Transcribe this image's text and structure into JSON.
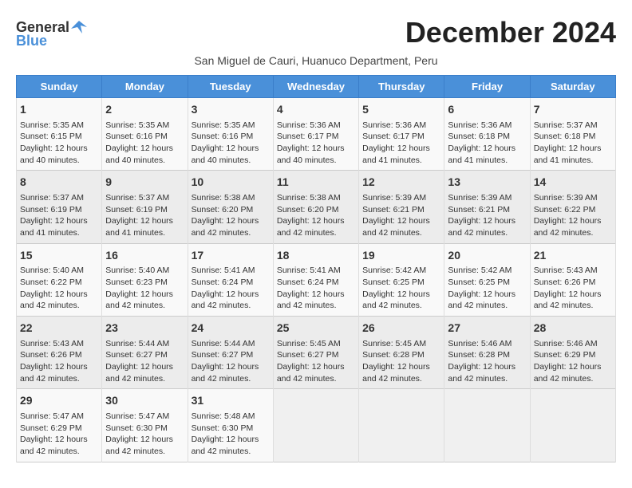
{
  "logo": {
    "general": "General",
    "blue": "Blue",
    "icon": "▶"
  },
  "title": "December 2024",
  "subtitle": "San Miguel de Cauri, Huanuco Department, Peru",
  "headers": [
    "Sunday",
    "Monday",
    "Tuesday",
    "Wednesday",
    "Thursday",
    "Friday",
    "Saturday"
  ],
  "weeks": [
    [
      {
        "day": "1",
        "info": "Sunrise: 5:35 AM\nSunset: 6:15 PM\nDaylight: 12 hours\nand 40 minutes."
      },
      {
        "day": "2",
        "info": "Sunrise: 5:35 AM\nSunset: 6:16 PM\nDaylight: 12 hours\nand 40 minutes."
      },
      {
        "day": "3",
        "info": "Sunrise: 5:35 AM\nSunset: 6:16 PM\nDaylight: 12 hours\nand 40 minutes."
      },
      {
        "day": "4",
        "info": "Sunrise: 5:36 AM\nSunset: 6:17 PM\nDaylight: 12 hours\nand 40 minutes."
      },
      {
        "day": "5",
        "info": "Sunrise: 5:36 AM\nSunset: 6:17 PM\nDaylight: 12 hours\nand 41 minutes."
      },
      {
        "day": "6",
        "info": "Sunrise: 5:36 AM\nSunset: 6:18 PM\nDaylight: 12 hours\nand 41 minutes."
      },
      {
        "day": "7",
        "info": "Sunrise: 5:37 AM\nSunset: 6:18 PM\nDaylight: 12 hours\nand 41 minutes."
      }
    ],
    [
      {
        "day": "8",
        "info": "Sunrise: 5:37 AM\nSunset: 6:19 PM\nDaylight: 12 hours\nand 41 minutes."
      },
      {
        "day": "9",
        "info": "Sunrise: 5:37 AM\nSunset: 6:19 PM\nDaylight: 12 hours\nand 41 minutes."
      },
      {
        "day": "10",
        "info": "Sunrise: 5:38 AM\nSunset: 6:20 PM\nDaylight: 12 hours\nand 42 minutes."
      },
      {
        "day": "11",
        "info": "Sunrise: 5:38 AM\nSunset: 6:20 PM\nDaylight: 12 hours\nand 42 minutes."
      },
      {
        "day": "12",
        "info": "Sunrise: 5:39 AM\nSunset: 6:21 PM\nDaylight: 12 hours\nand 42 minutes."
      },
      {
        "day": "13",
        "info": "Sunrise: 5:39 AM\nSunset: 6:21 PM\nDaylight: 12 hours\nand 42 minutes."
      },
      {
        "day": "14",
        "info": "Sunrise: 5:39 AM\nSunset: 6:22 PM\nDaylight: 12 hours\nand 42 minutes."
      }
    ],
    [
      {
        "day": "15",
        "info": "Sunrise: 5:40 AM\nSunset: 6:22 PM\nDaylight: 12 hours\nand 42 minutes."
      },
      {
        "day": "16",
        "info": "Sunrise: 5:40 AM\nSunset: 6:23 PM\nDaylight: 12 hours\nand 42 minutes."
      },
      {
        "day": "17",
        "info": "Sunrise: 5:41 AM\nSunset: 6:24 PM\nDaylight: 12 hours\nand 42 minutes."
      },
      {
        "day": "18",
        "info": "Sunrise: 5:41 AM\nSunset: 6:24 PM\nDaylight: 12 hours\nand 42 minutes."
      },
      {
        "day": "19",
        "info": "Sunrise: 5:42 AM\nSunset: 6:25 PM\nDaylight: 12 hours\nand 42 minutes."
      },
      {
        "day": "20",
        "info": "Sunrise: 5:42 AM\nSunset: 6:25 PM\nDaylight: 12 hours\nand 42 minutes."
      },
      {
        "day": "21",
        "info": "Sunrise: 5:43 AM\nSunset: 6:26 PM\nDaylight: 12 hours\nand 42 minutes."
      }
    ],
    [
      {
        "day": "22",
        "info": "Sunrise: 5:43 AM\nSunset: 6:26 PM\nDaylight: 12 hours\nand 42 minutes."
      },
      {
        "day": "23",
        "info": "Sunrise: 5:44 AM\nSunset: 6:27 PM\nDaylight: 12 hours\nand 42 minutes."
      },
      {
        "day": "24",
        "info": "Sunrise: 5:44 AM\nSunset: 6:27 PM\nDaylight: 12 hours\nand 42 minutes."
      },
      {
        "day": "25",
        "info": "Sunrise: 5:45 AM\nSunset: 6:27 PM\nDaylight: 12 hours\nand 42 minutes."
      },
      {
        "day": "26",
        "info": "Sunrise: 5:45 AM\nSunset: 6:28 PM\nDaylight: 12 hours\nand 42 minutes."
      },
      {
        "day": "27",
        "info": "Sunrise: 5:46 AM\nSunset: 6:28 PM\nDaylight: 12 hours\nand 42 minutes."
      },
      {
        "day": "28",
        "info": "Sunrise: 5:46 AM\nSunset: 6:29 PM\nDaylight: 12 hours\nand 42 minutes."
      }
    ],
    [
      {
        "day": "29",
        "info": "Sunrise: 5:47 AM\nSunset: 6:29 PM\nDaylight: 12 hours\nand 42 minutes."
      },
      {
        "day": "30",
        "info": "Sunrise: 5:47 AM\nSunset: 6:30 PM\nDaylight: 12 hours\nand 42 minutes."
      },
      {
        "day": "31",
        "info": "Sunrise: 5:48 AM\nSunset: 6:30 PM\nDaylight: 12 hours\nand 42 minutes."
      },
      null,
      null,
      null,
      null
    ]
  ]
}
